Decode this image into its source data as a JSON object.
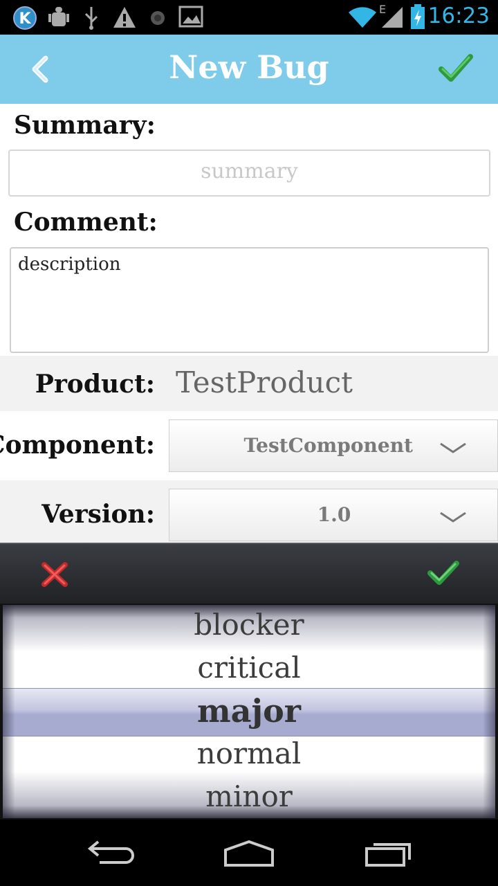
{
  "status_bar": {
    "time": "16:23",
    "network_type": "E",
    "icons": [
      "k-app-icon",
      "android-debug-icon",
      "usb-icon",
      "warning-icon",
      "record-icon",
      "image-icon",
      "wifi-icon",
      "signal-icon",
      "battery-charging-icon"
    ]
  },
  "action_bar": {
    "title": "New Bug",
    "back_icon": "chevron-left-icon",
    "done_icon": "checkmark-icon"
  },
  "form": {
    "summary_label": "Summary:",
    "summary_placeholder": "summary",
    "comment_label": "Comment:",
    "comment_value": "description",
    "product_label": "Product:",
    "product_value": "TestProduct",
    "component_label": "Component:",
    "component_value": "TestComponent",
    "version_label": "Version:",
    "version_value": "1.0"
  },
  "picker": {
    "cancel_icon": "close-icon",
    "ok_icon": "checkmark-icon",
    "options": [
      "blocker",
      "critical",
      "major",
      "normal",
      "minor"
    ],
    "selected": "major"
  },
  "nav_bar": {
    "icons": [
      "back-icon",
      "home-icon",
      "recent-apps-icon"
    ]
  },
  "colors": {
    "action_bar": "#7ecbea",
    "status_time": "#33b5e5",
    "check_green": "#3aa64a",
    "cancel_red": "#d83a3a"
  }
}
